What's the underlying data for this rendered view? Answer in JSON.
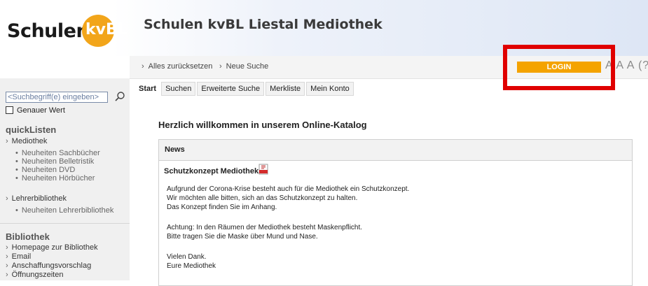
{
  "logo": {
    "text": "Schulen",
    "badge": "kvBL"
  },
  "site_title": "Schulen kvBL Liestal Mediothek",
  "toolbar": {
    "reset_all": "Alles zurücksetzen",
    "new_search": "Neue Suche",
    "login": "LOGIN",
    "font_sizes": "A A A (?"
  },
  "tabs": [
    "Start",
    "Suchen",
    "Erweiterte Suche",
    "Merkliste",
    "Mein Konto"
  ],
  "search": {
    "placeholder": "<Suchbegriff(e) eingeben>",
    "exact_label": "Genauer Wert"
  },
  "sidebar": {
    "quicklists_heading": "quickListen",
    "mediothek": "Mediothek",
    "mediothek_items": [
      "Neuheiten Sachbücher",
      "Neuheiten Belletristik",
      "Neuheiten DVD",
      "Neuheiten Hörbücher"
    ],
    "lehrerbibliothek": "Lehrerbibliothek",
    "lehrer_items": [
      "Neuheiten Lehrerbibliothek"
    ],
    "bibliothek_heading": "Bibliothek",
    "bibliothek_items": [
      "Homepage zur Bibliothek",
      "Email",
      "Anschaffungsvorschlag",
      "Öffnungszeiten"
    ]
  },
  "main": {
    "welcome": "Herzlich willkommen in unserem Online-Katalog",
    "news_heading": "News",
    "news_title": "Schutzkonzept Mediothek",
    "para1": [
      "Aufgrund der Corona-Krise besteht auch für die Mediothek ein Schutzkonzept.",
      "Wir möchten alle bitten, sich an das Schutzkonzept zu halten.",
      "Das Konzept finden Sie im Anhang."
    ],
    "para2": [
      "Achtung: In den Räumen der Mediothek besteht Maskenpflicht.",
      "Bitte tragen Sie die Maske über Mund und Nase."
    ],
    "para3": [
      "Vielen Dank.",
      "Eure Mediothek"
    ]
  },
  "colors": {
    "accent": "#f4a300",
    "highlight_box": "#e00000",
    "logo_orange": "#f2a51a"
  },
  "icons": [
    "search-icon",
    "pdf-icon",
    "chevron-right-icon"
  ]
}
